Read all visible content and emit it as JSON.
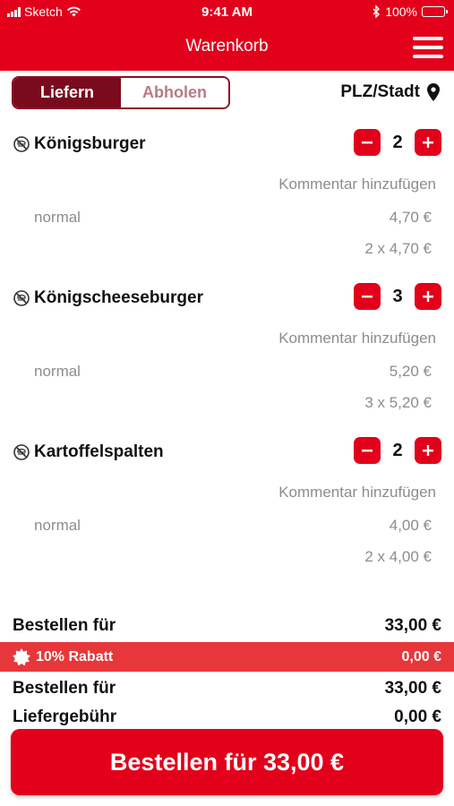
{
  "status_bar": {
    "carrier": "Sketch",
    "time": "9:41 AM",
    "battery": "100%"
  },
  "header": {
    "title": "Warenkorb",
    "menu_icon": "hamburger-menu-icon"
  },
  "mode_toggle": {
    "options": [
      {
        "label": "Liefern",
        "selected": true
      },
      {
        "label": "Abholen",
        "selected": false
      }
    ]
  },
  "location": {
    "label": "PLZ/Stadt",
    "icon": "location-pin-icon"
  },
  "items": [
    {
      "name": "Königsburger",
      "quantity": "2",
      "comment_label": "Kommentar hinzufügen",
      "variant": "normal",
      "unit_price": "4,70 €",
      "calculation": "2 x 4,70 €",
      "icon": "no-allergen-icon"
    },
    {
      "name": "Königscheeseburger",
      "quantity": "3",
      "comment_label": "Kommentar hinzufügen",
      "variant": "normal",
      "unit_price": "5,20 €",
      "calculation": "3 x 5,20 €",
      "icon": "no-allergen-icon"
    },
    {
      "name": "Kartoffelspalten",
      "quantity": "2",
      "comment_label": "Kommentar hinzufügen",
      "variant": "normal",
      "unit_price": "4,00 €",
      "calculation": "2 x 4,00 €",
      "icon": "no-allergen-icon"
    }
  ],
  "summary": {
    "subtotal_label": "Bestellen für",
    "subtotal_value": "33,00 €",
    "discount_label": "10% Rabatt",
    "discount_value": "0,00 €",
    "total_label": "Bestellen für",
    "total_value": "33,00 €",
    "delivery_fee_label": "Liefergebühr",
    "delivery_fee_value": "0,00 €"
  },
  "order_button": {
    "label": "Bestellen für 33,00 €"
  },
  "colors": {
    "brand_red": "#e2001a",
    "toggle_dark": "#7a0b1e",
    "discount_red": "#e8373b",
    "muted_text": "#8c8c8c"
  }
}
